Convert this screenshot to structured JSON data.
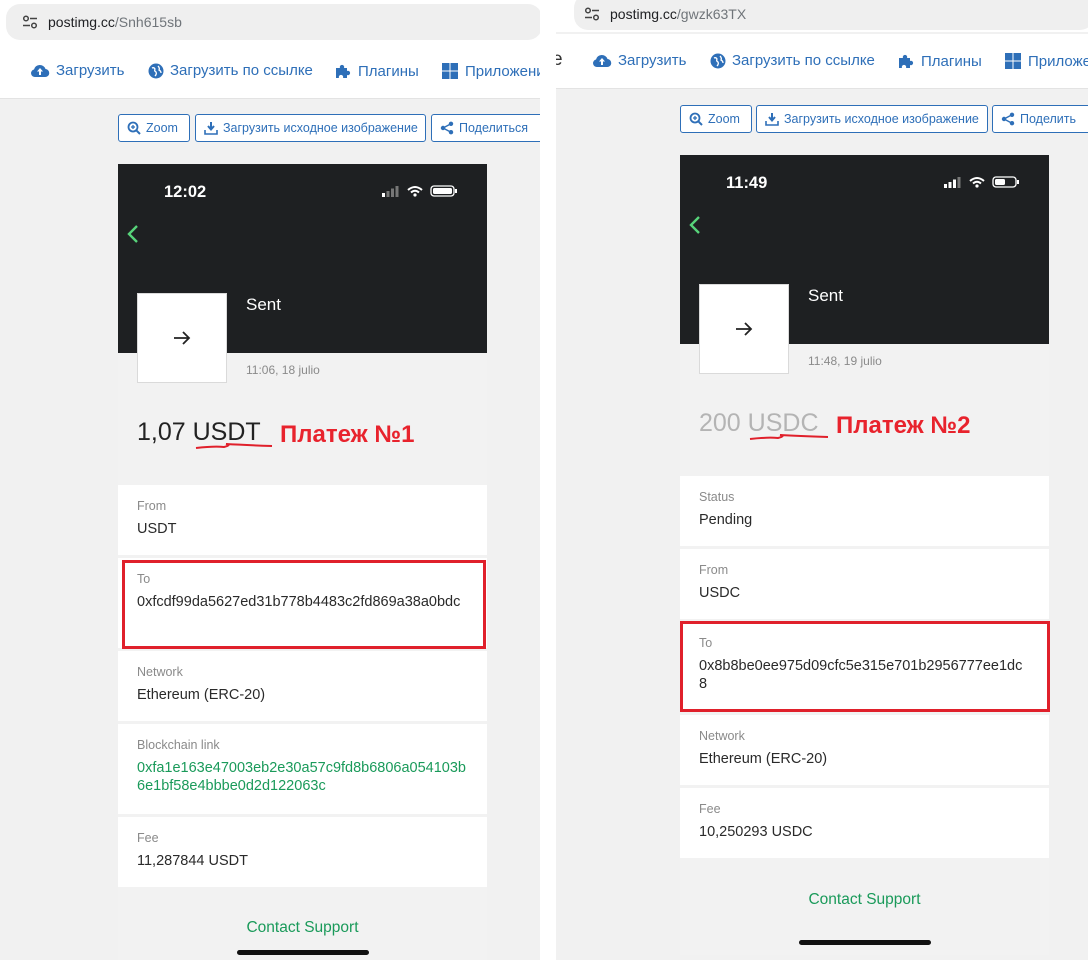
{
  "left": {
    "url": {
      "host": "postimg.cc",
      "path": "/Snh615sb"
    },
    "nav": [
      "Загрузить",
      "Загрузить по ссылке",
      "Плагины",
      "Приложени"
    ],
    "toolbar": {
      "zoom": "Zoom",
      "download": "Загрузить исходное изображение",
      "share": "Поделиться"
    },
    "phone": {
      "time": "12:02",
      "title": "Sent",
      "date": "11:06, 18 julio",
      "amount_number": "1,07",
      "amount_currency": "USDT",
      "annotation": "Платеж №1",
      "rows": [
        {
          "label": "From",
          "value": "USDT"
        },
        {
          "label": "To",
          "value": "0xfcdf99da5627ed31b778b4483c2fd869a38a0bdc"
        },
        {
          "label": "Network",
          "value": "Ethereum (ERC-20)"
        },
        {
          "label": "Blockchain link",
          "value": "0xfa1e163e47003eb2e30a57c9fd8b6806a054103b6e1bf58e4bbbe0d2d122063c"
        },
        {
          "label": "Fee",
          "value": "11,287844 USDT"
        }
      ],
      "support": "Contact Support"
    }
  },
  "right": {
    "url": {
      "host": "postimg.cc",
      "path": "/gwzk63TX"
    },
    "nav": [
      "Загрузить",
      "Загрузить по ссылке",
      "Плагины",
      "Приложе"
    ],
    "toolbar": {
      "zoom": "Zoom",
      "download": "Загрузить исходное изображение",
      "share": "Поделить"
    },
    "edge_glyph": "e",
    "phone": {
      "time": "11:49",
      "title": "Sent",
      "date": "11:48, 19 julio",
      "amount_number": "200",
      "amount_currency": "USDC",
      "annotation": "Платеж №2",
      "rows": [
        {
          "label": "Status",
          "value": "Pending"
        },
        {
          "label": "From",
          "value": "USDC"
        },
        {
          "label": "To",
          "value": "0x8b8be0ee975d09cfc5e315e701b2956777ee1dc8"
        },
        {
          "label": "Network",
          "value": "Ethereum (ERC-20)"
        },
        {
          "label": "Fee",
          "value": "10,250293 USDC"
        }
      ],
      "support": "Contact Support"
    }
  },
  "colors": {
    "link_green": "#1a9a5a",
    "annotation_red": "#e8232d",
    "brand_blue": "#2e6fb8",
    "header_dark": "#1e2022"
  },
  "icons": [
    "tune-icon",
    "cloud-upload-icon",
    "globe-icon",
    "puzzle-icon",
    "windows-icon",
    "zoom-icon",
    "download-icon",
    "share-icon",
    "back-arrow-icon",
    "arrow-right-icon",
    "signal-icon",
    "wifi-icon",
    "battery-icon"
  ]
}
